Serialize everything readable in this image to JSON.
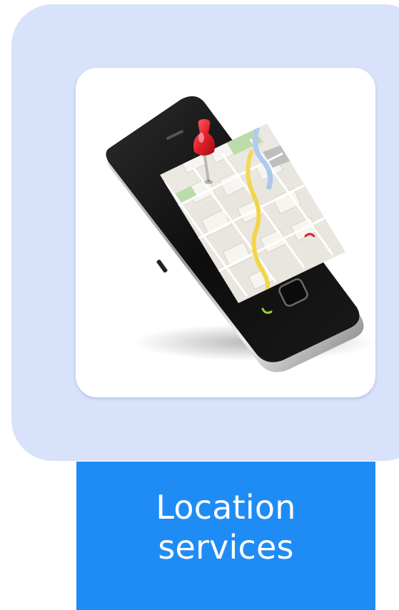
{
  "tile": {
    "caption_line1": "Location",
    "caption_line2": "services",
    "image_subject": "smartphone-with-map-and-location-pin",
    "colors": {
      "panel_background": "#d8e2fa",
      "caption_background": "#1f8cf5",
      "caption_text": "#ffffff",
      "pin": "#e3202a"
    }
  }
}
